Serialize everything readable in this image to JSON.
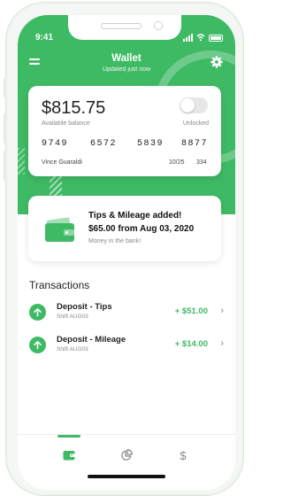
{
  "status_bar": {
    "time": "9:41"
  },
  "header": {
    "title": "Wallet",
    "subtitle": "Updated just now",
    "icons": {
      "menu": "hamburger-menu-icon",
      "settings": "gear-icon"
    }
  },
  "card": {
    "balance": "$815.75",
    "balance_label": "Available balance",
    "lock_toggle_on": false,
    "lock_label": "Unlocked",
    "number_groups": [
      "9749",
      "6572",
      "5839",
      "8877"
    ],
    "holder": "Vince Guaraldi",
    "expiry": "10/25",
    "cvv": "334"
  },
  "notice": {
    "title": "Tips & Mileage added!",
    "amount_line": "$65.00 from Aug 03, 2020",
    "subtitle": "Money in the bank!",
    "icon": "wallet-icon"
  },
  "transactions": {
    "title": "Transactions",
    "items": [
      {
        "title": "Deposit - Tips",
        "subtitle": "Shift AUG03",
        "amount": "+ $51.00",
        "icon": "arrow-up-icon"
      },
      {
        "title": "Deposit - Mileage",
        "subtitle": "Shift AUG03",
        "amount": "+ $14.00",
        "icon": "arrow-up-icon"
      }
    ]
  },
  "tabbar": {
    "tabs": [
      {
        "icon": "wallet-icon",
        "active": true
      },
      {
        "icon": "pie-chart-icon",
        "active": false
      },
      {
        "icon": "dollar-icon",
        "label": "$",
        "active": false
      }
    ]
  },
  "colors": {
    "brand_green": "#3fba64",
    "text_dark": "#222222",
    "text_muted": "#8a8a8a"
  }
}
